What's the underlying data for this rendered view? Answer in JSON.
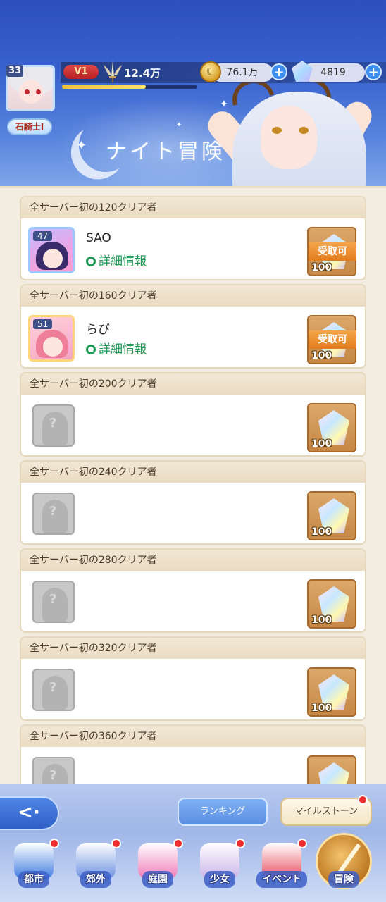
{
  "header": {
    "title": "ナイト冒険",
    "player_level": "33",
    "player_rank": "石騎士Ⅰ",
    "vip": "V1",
    "power": "12.4万",
    "exp_progress": 0.62,
    "coins": "76.1万",
    "gems": "4819",
    "icons": {
      "coin": "coin-icon",
      "gem": "gem-icon",
      "add": "plus-icon",
      "power": "winged-sword-icon"
    }
  },
  "milestones": [
    {
      "heading": "全サーバー初の120クリア者",
      "player": {
        "name": "SAO",
        "level": "47",
        "detail_label": "詳細情報"
      },
      "reward_qty": "100",
      "claim_label": "受取可"
    },
    {
      "heading": "全サーバー初の160クリア者",
      "player": {
        "name": "らび",
        "level": "51",
        "detail_label": "詳細情報"
      },
      "reward_qty": "100",
      "claim_label": "受取可"
    },
    {
      "heading": "全サーバー初の200クリア者",
      "player": null,
      "reward_qty": "100"
    },
    {
      "heading": "全サーバー初の240クリア者",
      "player": null,
      "reward_qty": "100"
    },
    {
      "heading": "全サーバー初の280クリア者",
      "player": null,
      "reward_qty": "100"
    },
    {
      "heading": "全サーバー初の320クリア者",
      "player": null,
      "reward_qty": "100"
    },
    {
      "heading": "全サーバー初の360クリア者",
      "player": null,
      "reward_qty": ""
    }
  ],
  "footer": {
    "back_icon": "back-arrow-icon",
    "ranking_label": "ランキング",
    "milestone_label": "マイルストーン"
  },
  "nav": [
    {
      "label": "都市",
      "icon": "castle-icon",
      "badge": true,
      "color": "#3d7be0"
    },
    {
      "label": "郊外",
      "icon": "compass-icon",
      "badge": true,
      "color": "#6b8fe0"
    },
    {
      "label": "庭園",
      "icon": "heart-icon",
      "badge": true,
      "color": "#f07ab8"
    },
    {
      "label": "少女",
      "icon": "girl-icon",
      "badge": true,
      "color": "#c9b4e8"
    },
    {
      "label": "イベント",
      "icon": "gift-icon",
      "badge": true,
      "color": "#e84b5e"
    },
    {
      "label": "冒険",
      "icon": "sword-icon",
      "badge": false,
      "active": true,
      "color": "#c88428"
    }
  ]
}
